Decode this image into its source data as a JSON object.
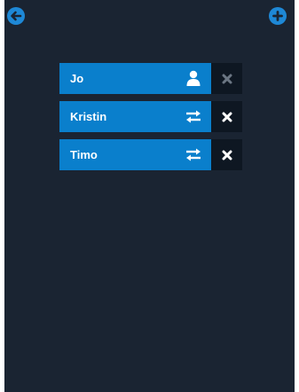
{
  "toolbar": {
    "back_icon": "arrow-left-circle-icon",
    "add_icon": "plus-circle-icon"
  },
  "players": [
    {
      "name": "Jo",
      "icon": "user-icon",
      "remove_enabled": false
    },
    {
      "name": "Kristin",
      "icon": "swap-arrows-icon",
      "remove_enabled": true
    },
    {
      "name": "Timo",
      "icon": "swap-arrows-icon",
      "remove_enabled": true
    }
  ],
  "colors": {
    "background": "#1a2432",
    "accent": "#0a7fcc",
    "button_blue": "#1e88d6",
    "delete_bg": "#0e1722",
    "delete_active": "#ffffff",
    "delete_disabled": "#6b7683"
  }
}
